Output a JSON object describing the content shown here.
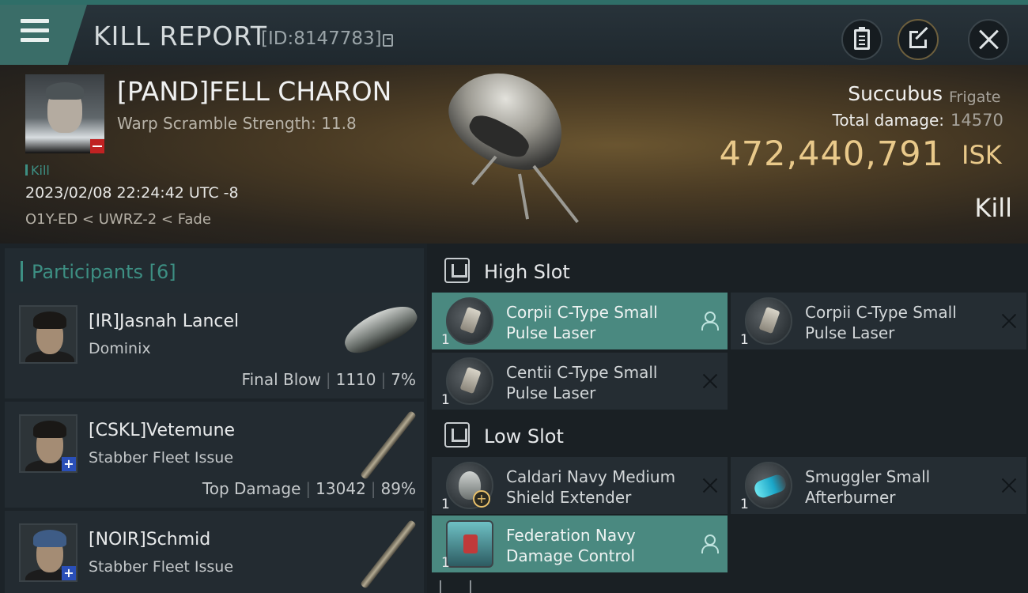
{
  "header": {
    "title": "KILL REPORT",
    "report_id": "[ID:8147783]",
    "icons": [
      "menu-icon",
      "copy-icon",
      "clipboard-icon",
      "share-icon",
      "close-icon"
    ]
  },
  "victim": {
    "name": "[PAND]FELL CHARON",
    "warp_scramble": "Warp Scramble Strength: 11.8",
    "tag": "Kill",
    "timestamp": "2023/02/08 22:24:42 UTC -8",
    "location": "O1Y-ED < UWRZ-2 < Fade",
    "ship_name": "Succubus",
    "ship_class": "Frigate",
    "damage_label": "Total damage:",
    "damage_value": "14570",
    "isk_value": "472,440,791",
    "isk_unit": "ISK",
    "result": "Kill"
  },
  "participants": {
    "title": "Participants [6]",
    "rows": [
      {
        "name": "[IR]Jasnah Lancel",
        "ship": "Dominix",
        "role": "Final Blow",
        "damage": "1110",
        "percent": "7%"
      },
      {
        "name": "[CSKL]Vetemune",
        "ship": "Stabber Fleet Issue",
        "role": "Top Damage",
        "damage": "13042",
        "percent": "89%"
      },
      {
        "name": "[NOIR]Schmid",
        "ship": "Stabber Fleet Issue",
        "role": "",
        "damage": "",
        "percent": ""
      }
    ]
  },
  "fitting": {
    "high_slot_label": "High Slot",
    "low_slot_label": "Low Slot",
    "high": [
      {
        "qty": "1",
        "line1": "Corpii C-Type Small",
        "line2": "Pulse Laser",
        "state": "dropped"
      },
      {
        "qty": "1",
        "line1": "Corpii C-Type Small",
        "line2": "Pulse Laser",
        "state": "destroyed"
      },
      {
        "qty": "1",
        "line1": "Centii C-Type Small",
        "line2": "Pulse Laser",
        "state": "destroyed"
      }
    ],
    "low": [
      {
        "qty": "1",
        "line1": "Caldari Navy Medium",
        "line2": "Shield Extender",
        "state": "destroyed"
      },
      {
        "qty": "1",
        "line1": "Smuggler Small",
        "line2": "Afterburner",
        "state": "destroyed"
      },
      {
        "qty": "1",
        "line1": "Federation Navy",
        "line2": "Damage Control",
        "state": "dropped"
      }
    ]
  },
  "colors": {
    "accent_teal": "#3d8f83",
    "highlight_slot": "#4a8980",
    "isk_gold": "#e9c98a",
    "destroyed_badge": "#c02222",
    "ally_badge": "#2a4fb8"
  }
}
